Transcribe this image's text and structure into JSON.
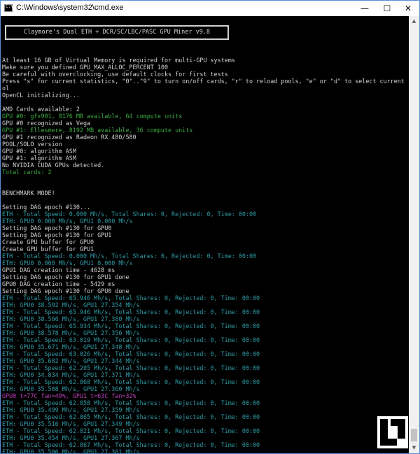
{
  "window": {
    "title": "C:\\Windows\\system32\\cmd.exe",
    "minimize_glyph": "—",
    "maximize_glyph": "☐",
    "close_glyph": "✕"
  },
  "banner": "Claymore's Dual ETH + DCR/SC/LBC/PASC GPU Miner v9.8",
  "colors": {
    "white": "#d2d2d2",
    "green": "#3dac42",
    "teal": "#2e9aa4",
    "magenta": "#b93fb6",
    "titlebar": "#ffffff",
    "console_bg": "#000000"
  },
  "console_lines": [
    {
      "text": "",
      "color": "white"
    },
    {
      "text": "At least 16 GB of Virtual Memory is required for multi-GPU systems",
      "color": "white"
    },
    {
      "text": "Make sure you defined GPU_MAX_ALLOC_PERCENT 100",
      "color": "white"
    },
    {
      "text": "Be careful with overclocking, use default clocks for first tests",
      "color": "white"
    },
    {
      "text": "Press \"s\" for current statistics, \"0\"..\"9\" to turn on/off cards, \"r\" to reload pools, \"e\" or \"d\" to select current po",
      "color": "white"
    },
    {
      "text": "ol",
      "color": "white"
    },
    {
      "text": "OpenCL initializing...",
      "color": "white"
    },
    {
      "text": "",
      "color": "white"
    },
    {
      "text": "AMD Cards available: 2",
      "color": "white"
    },
    {
      "text": "GPU #0: gfx901, 8176 MB available, 64 compute units",
      "color": "green"
    },
    {
      "text": "GPU #0 recognized as Vega",
      "color": "white"
    },
    {
      "text": "GPU #1: Ellesmere, 8192 MB available, 36 compute units",
      "color": "green"
    },
    {
      "text": "GPU #1 recognized as Radeon RX 480/580",
      "color": "white"
    },
    {
      "text": "POOL/SOLO version",
      "color": "white"
    },
    {
      "text": "GPU #0: algorithm ASM",
      "color": "white"
    },
    {
      "text": "GPU #1: algorithm ASM",
      "color": "white"
    },
    {
      "text": "No NVIDIA CUDA GPUs detected.",
      "color": "white"
    },
    {
      "text": "Total cards: 2",
      "color": "green"
    },
    {
      "text": "",
      "color": "white"
    },
    {
      "text": "",
      "color": "white"
    },
    {
      "text": "BENCHMARK MODE!",
      "color": "white"
    },
    {
      "text": "",
      "color": "white"
    },
    {
      "text": "Setting DAG epoch #130...",
      "color": "white"
    },
    {
      "text": "ETH - Total Speed: 0.000 Mh/s, Total Shares: 0, Rejected: 0, Time: 00:00",
      "color": "teal"
    },
    {
      "text": "ETH: GPU0 0.000 Mh/s, GPU1 0.000 Mh/s",
      "color": "teal"
    },
    {
      "text": "Setting DAG epoch #130 for GPU0",
      "color": "white"
    },
    {
      "text": "Setting DAG epoch #130 for GPU1",
      "color": "white"
    },
    {
      "text": "Create GPU buffer for GPU0",
      "color": "white"
    },
    {
      "text": "Create GPU buffer for GPU1",
      "color": "white"
    },
    {
      "text": "ETH - Total Speed: 0.000 Mh/s, Total Shares: 0, Rejected: 0, Time: 00:00",
      "color": "teal"
    },
    {
      "text": "ETH: GPU0 0.000 Mh/s, GPU1 0.000 Mh/s",
      "color": "teal"
    },
    {
      "text": "GPU1 DAG creation time - 4628 ms",
      "color": "white"
    },
    {
      "text": "Setting DAG epoch #130 for GPU1 done",
      "color": "white"
    },
    {
      "text": "GPU0 DAG creation time - 5429 ms",
      "color": "white"
    },
    {
      "text": "Setting DAG epoch #130 for GPU0 done",
      "color": "white"
    },
    {
      "text": "ETH - Total Speed: 65.946 Mh/s, Total Shares: 0, Rejected: 0, Time: 00:00",
      "color": "teal"
    },
    {
      "text": "ETH: GPU0 38.592 Mh/s, GPU1 27.354 Mh/s",
      "color": "teal"
    },
    {
      "text": "ETH - Total Speed: 65.946 Mh/s, Total Shares: 0, Rejected: 0, Time: 00:00",
      "color": "teal"
    },
    {
      "text": "ETH: GPU0 38.566 Mh/s, GPU1 27.380 Mh/s",
      "color": "teal"
    },
    {
      "text": "ETH - Total Speed: 65.934 Mh/s, Total Shares: 0, Rejected: 0, Time: 00:00",
      "color": "teal"
    },
    {
      "text": "ETH: GPU0 38.578 Mh/s, GPU1 27.356 Mh/s",
      "color": "teal"
    },
    {
      "text": "ETH - Total Speed: 63.019 Mh/s, Total Shares: 0, Rejected: 0, Time: 00:00",
      "color": "teal"
    },
    {
      "text": "ETH: GPU0 35.671 Mh/s, GPU1 27.348 Mh/s",
      "color": "teal"
    },
    {
      "text": "ETH - Total Speed: 63.026 Mh/s, Total Shares: 0, Rejected: 0, Time: 00:00",
      "color": "teal"
    },
    {
      "text": "ETH: GPU0 35.682 Mh/s, GPU1 27.344 Mh/s",
      "color": "teal"
    },
    {
      "text": "ETH - Total Speed: 62.205 Mh/s, Total Shares: 0, Rejected: 0, Time: 00:00",
      "color": "teal"
    },
    {
      "text": "ETH: GPU0 34.834 Mh/s, GPU1 27.371 Mh/s",
      "color": "teal"
    },
    {
      "text": "ETH - Total Speed: 62.868 Mh/s, Total Shares: 0, Rejected: 0, Time: 00:00",
      "color": "teal"
    },
    {
      "text": "ETH: GPU0 35.508 Mh/s, GPU1 27.360 Mh/s",
      "color": "teal"
    },
    {
      "text": "GPU0 t=77C fan=49%, GPU1 t=63C fan=32%",
      "color": "magenta"
    },
    {
      "text": "ETH - Total Speed: 62.858 Mh/s, Total Shares: 0, Rejected: 0, Time: 00:00",
      "color": "teal"
    },
    {
      "text": "ETH: GPU0 35.499 Mh/s, GPU1 27.359 Mh/s",
      "color": "teal"
    },
    {
      "text": "ETH - Total Speed: 62.865 Mh/s, Total Shares: 0, Rejected: 0, Time: 00:00",
      "color": "teal"
    },
    {
      "text": "ETH: GPU0 35.516 Mh/s, GPU1 27.349 Mh/s",
      "color": "teal"
    },
    {
      "text": "ETH - Total Speed: 62.821 Mh/s, Total Shares: 0, Rejected: 0, Time: 00:00",
      "color": "teal"
    },
    {
      "text": "ETH: GPU0 35.454 Mh/s, GPU1 27.367 Mh/s",
      "color": "teal"
    },
    {
      "text": "ETH - Total Speed: 62.867 Mh/s, Total Shares: 0, Rejected: 0, Time: 00:00",
      "color": "teal"
    },
    {
      "text": "ETH: GPU0 35.506 Mh/s, GPU1 27.361 Mh/s",
      "color": "teal"
    }
  ]
}
